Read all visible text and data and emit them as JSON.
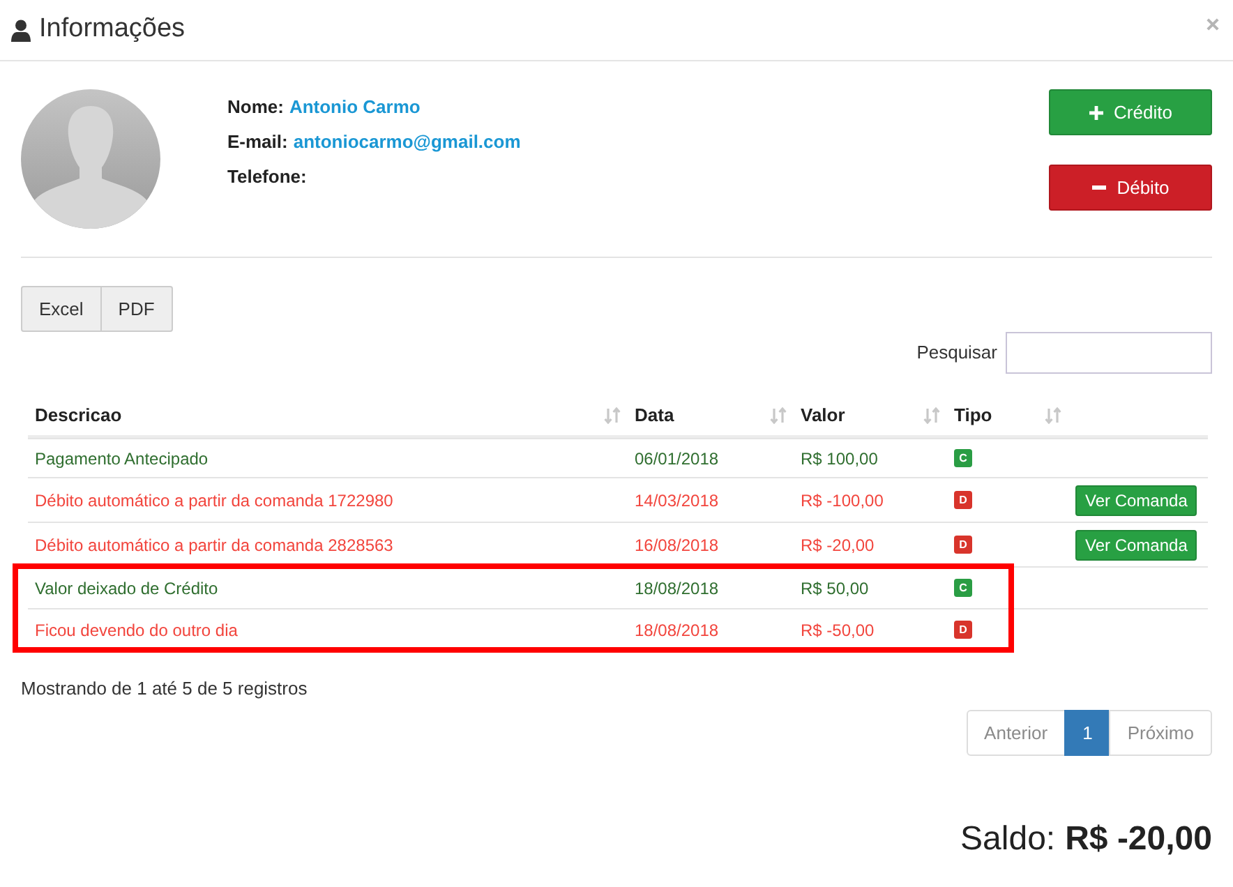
{
  "dialog": {
    "title": "Informações"
  },
  "profile": {
    "fields": [
      {
        "label": "Nome:",
        "value": "Antonio Carmo"
      },
      {
        "label": "E-mail:",
        "value": "antoniocarmo@gmail.com"
      },
      {
        "label": "Telefone:"
      }
    ]
  },
  "actions": [
    {
      "label": "Crédito",
      "kind": "credit"
    },
    {
      "label": "Débito",
      "kind": "debit"
    }
  ],
  "export_buttons": [
    "Excel",
    "PDF"
  ],
  "search": {
    "label": "Pesquisar"
  },
  "table": {
    "columns": [
      "Descricao",
      "Data",
      "Valor",
      "Tipo"
    ],
    "rows": [
      {
        "description": "Pagamento Antecipado",
        "date": "06/01/2018",
        "value": "R$ 100,00",
        "type": "C",
        "kind": "credit",
        "highlighted": false
      },
      {
        "description": "Débito automático a partir da comanda 1722980",
        "date": "14/03/2018",
        "value": "R$ -100,00",
        "type": "D",
        "kind": "debit",
        "action": "Ver Comanda",
        "highlighted": false
      },
      {
        "description": "Débito automático a partir da comanda 2828563",
        "date": "16/08/2018",
        "value": "R$ -20,00",
        "type": "D",
        "kind": "debit",
        "action": "Ver Comanda",
        "highlighted": false
      },
      {
        "description": "Valor deixado de Crédito",
        "date": "18/08/2018",
        "value": "R$ 50,00",
        "type": "C",
        "kind": "credit",
        "highlighted": true
      },
      {
        "description": "Ficou devendo do outro dia",
        "date": "18/08/2018",
        "value": "R$ -50,00",
        "type": "D",
        "kind": "debit",
        "highlighted": true
      }
    ]
  },
  "info": "Mostrando de 1 até 5 de 5 registros",
  "pagination": [
    {
      "label": "Anterior",
      "selected": false,
      "disabled": true
    },
    {
      "label": "1",
      "selected": true,
      "disabled": false
    },
    {
      "label": "Próximo",
      "selected": false,
      "disabled": true
    }
  ],
  "balance": {
    "label": "Saldo:",
    "value": "R$ -20,00"
  }
}
